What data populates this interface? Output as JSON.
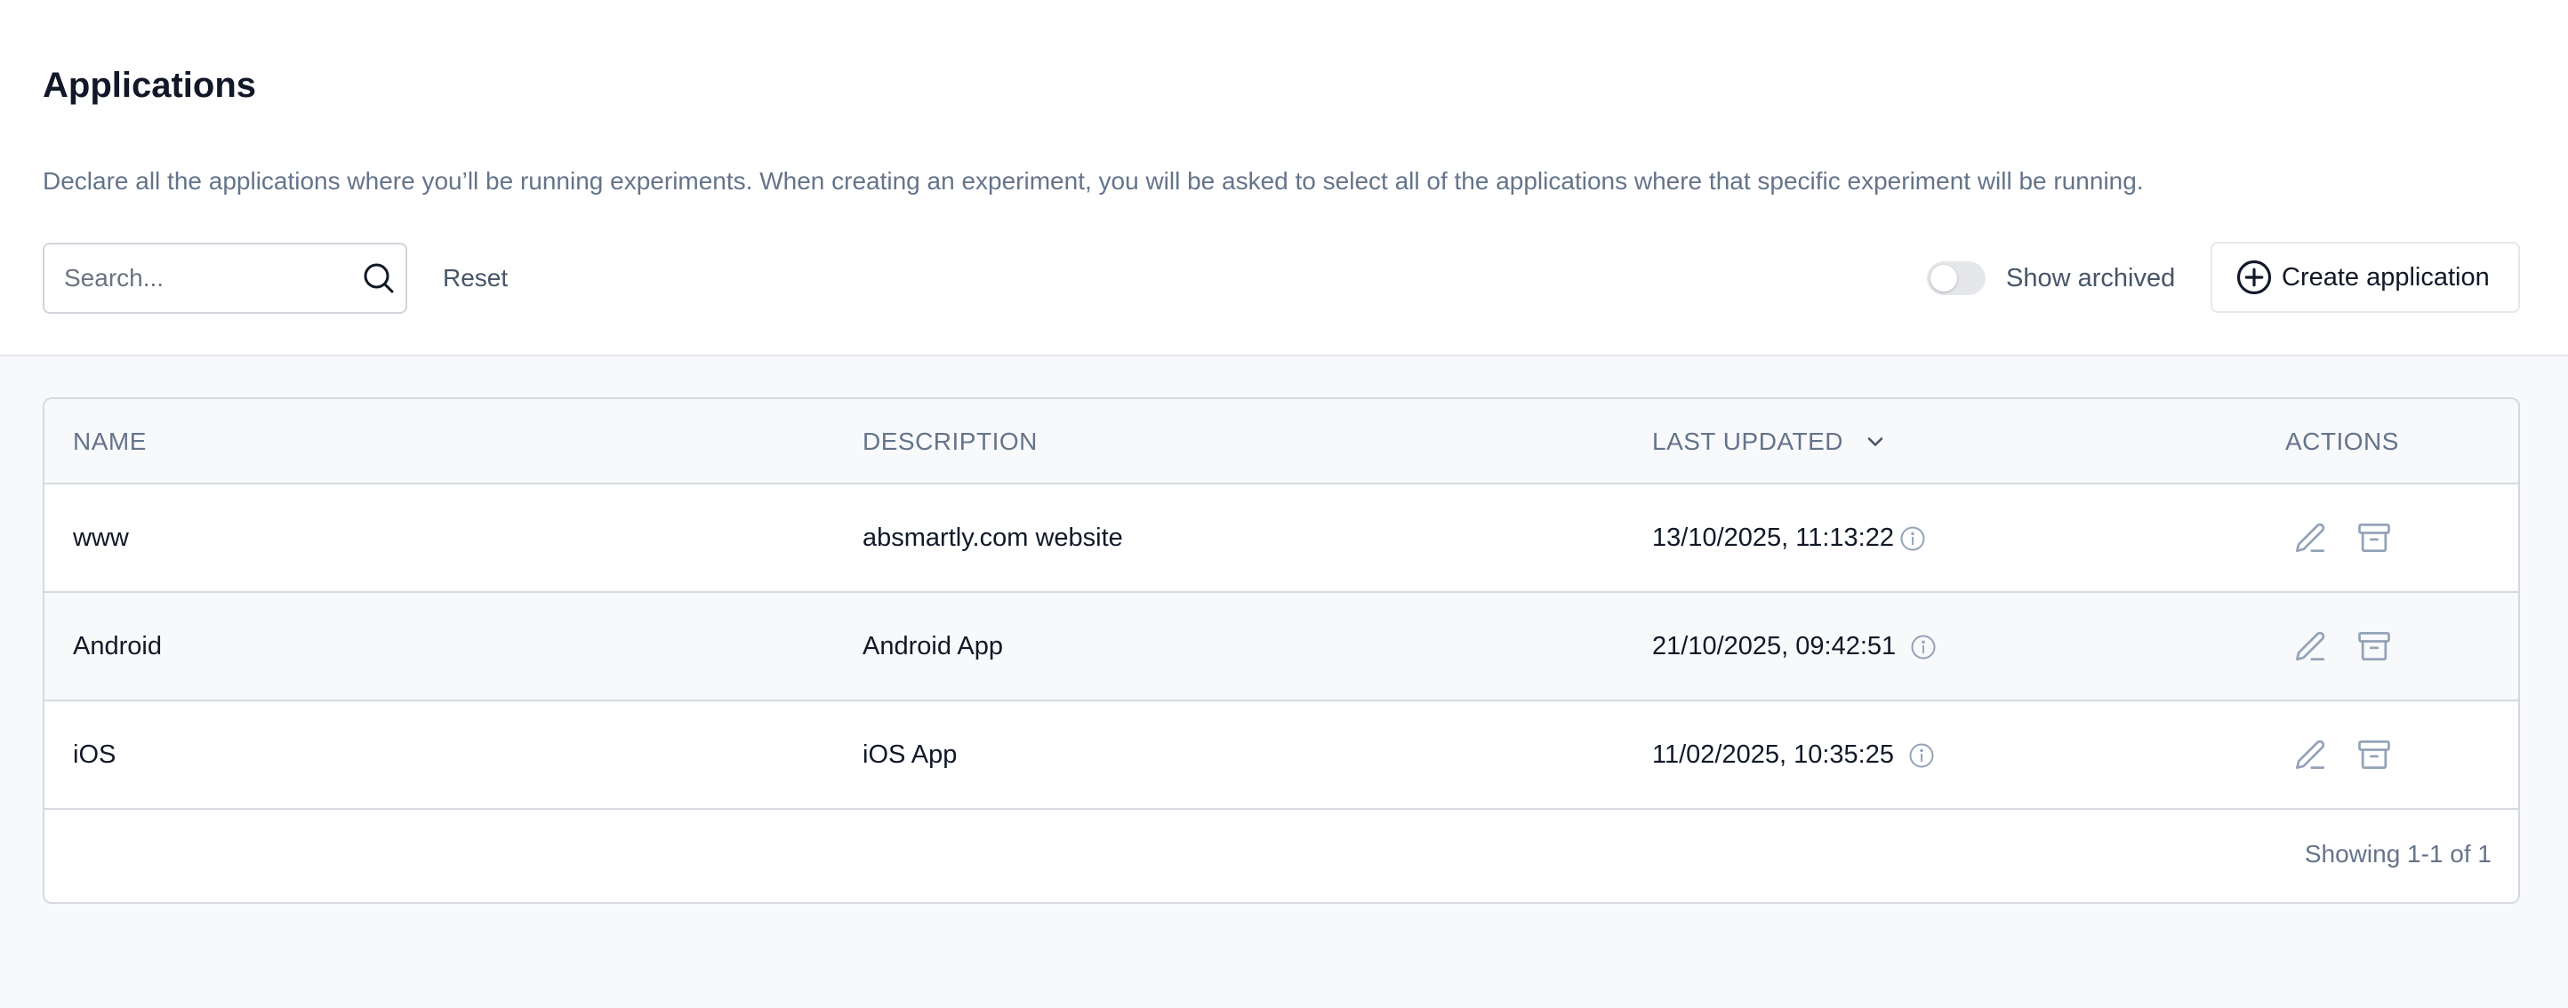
{
  "page": {
    "title": "Applications",
    "description": "Declare all the applications where you’ll be running experiments. When creating an experiment, you will be asked to select all of the applications where that specific experiment will be running."
  },
  "toolbar": {
    "search_placeholder": "Search...",
    "search_value": "",
    "reset_label": "Reset",
    "show_archived_label": "Show archived",
    "show_archived_on": false,
    "create_label": "Create application"
  },
  "table": {
    "columns": [
      "NAME",
      "DESCRIPTION",
      "LAST UPDATED",
      "ACTIONS"
    ],
    "sorted_column": "LAST UPDATED",
    "rows": [
      {
        "name": "www",
        "description": "absmartly.com website",
        "last_updated": "13/10/2025, 11:13:22"
      },
      {
        "name": "Android",
        "description": "Android App",
        "last_updated": "21/10/2025, 09:42:51"
      },
      {
        "name": "iOS",
        "description": "iOS App",
        "last_updated": "11/02/2025, 10:35:25"
      }
    ],
    "footer": "Showing 1-1 of 1"
  },
  "colors": {
    "text_primary": "#111827",
    "text_muted": "#64748b",
    "border": "#d5d9df",
    "surface_alt": "#f8f9fb"
  },
  "icons": {
    "search": "search-icon",
    "toggle": "toggle-switch",
    "create": "plus-circle-icon",
    "sort": "chevron-down-icon",
    "info": "info-icon",
    "edit": "pencil-icon",
    "archive": "archive-box-icon"
  }
}
